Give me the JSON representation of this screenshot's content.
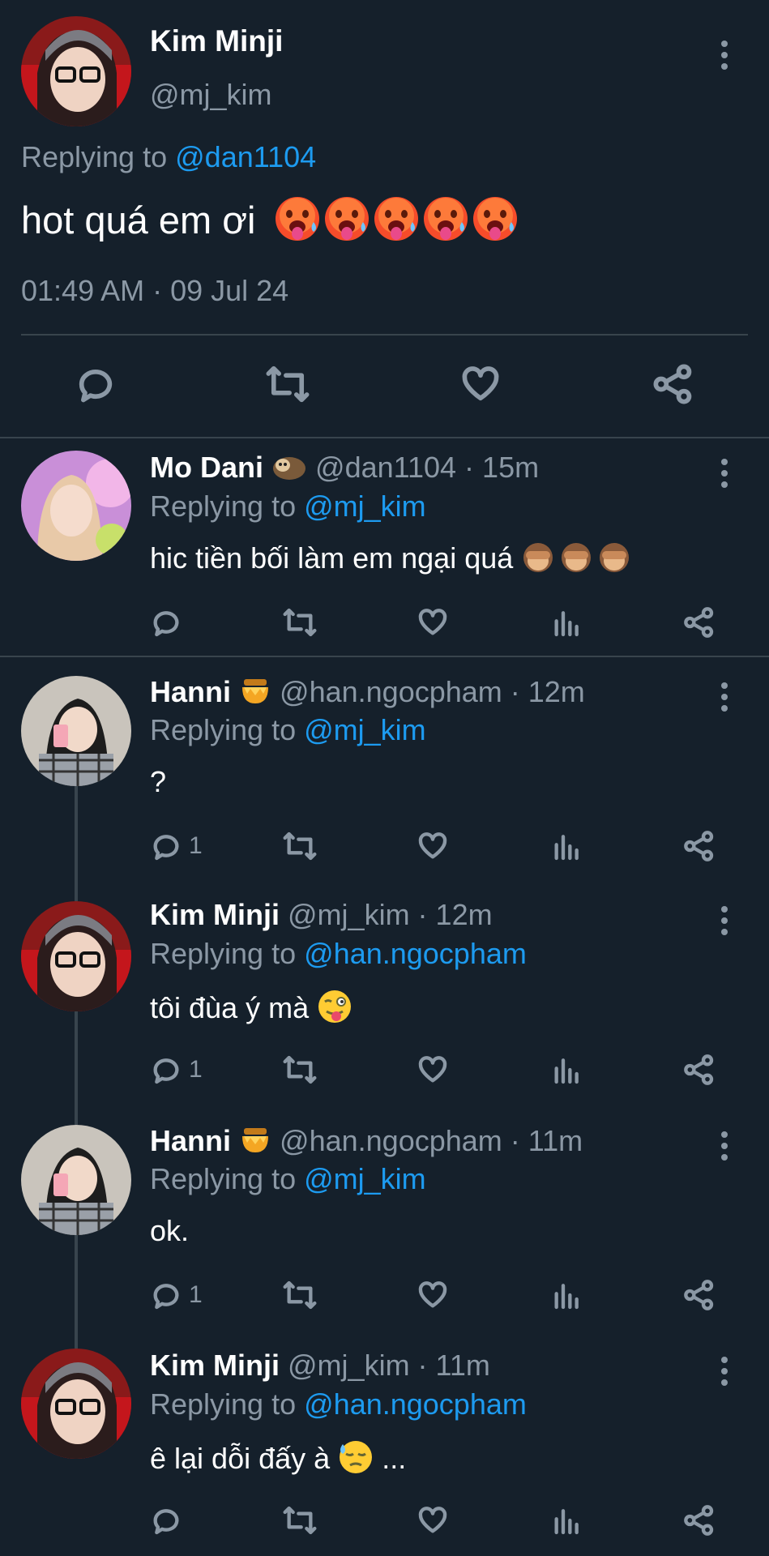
{
  "main_tweet": {
    "author_name": "Kim Minji",
    "handle": "@mj_kim",
    "replying_prefix": "Replying to",
    "replying_to": "@dan1104",
    "text": "hot quá em ơi",
    "emoji": "hot-face-emoji x5",
    "timestamp": "01:49 AM · 09 Jul 24"
  },
  "replies": [
    {
      "name": "Mo Dani",
      "handle": "@dan1104 · 15m",
      "badge": "sloth-emoji",
      "replying_prefix": "Replying to",
      "replying_to": "@mj_kim",
      "text": "hic tiền bối làm em ngại quá",
      "emoji": "see-no-evil-monkey-emoji x3",
      "reply_count": ""
    },
    {
      "name": "Hanni",
      "handle": "@han.ngocpham · 12m",
      "badge": "honey-pot-emoji",
      "replying_prefix": "Replying to",
      "replying_to": "@mj_kim",
      "text": "?",
      "reply_count": "1"
    },
    {
      "name": "Kim Minji",
      "handle": "@mj_kim · 12m",
      "replying_prefix": "Replying to",
      "replying_to": "@han.ngocpham",
      "text": "tôi đùa ý mà",
      "emoji": "winking-tongue-emoji",
      "reply_count": "1"
    },
    {
      "name": "Hanni",
      "handle": "@han.ngocpham · 11m",
      "badge": "honey-pot-emoji",
      "replying_prefix": "Replying to",
      "replying_to": "@mj_kim",
      "text": "ok.",
      "reply_count": "1"
    },
    {
      "name": "Kim Minji",
      "handle": "@mj_kim · 11m",
      "replying_prefix": "Replying to",
      "replying_to": "@han.ngocpham",
      "text": "ê lại dỗi đấy à",
      "emoji": "downcast-sweat-emoji",
      "text_suffix": "...",
      "reply_count": ""
    }
  ],
  "colors": {
    "background": "#15202b",
    "link": "#1d9bf0",
    "muted": "#8b98a5",
    "divider": "#38444d"
  }
}
